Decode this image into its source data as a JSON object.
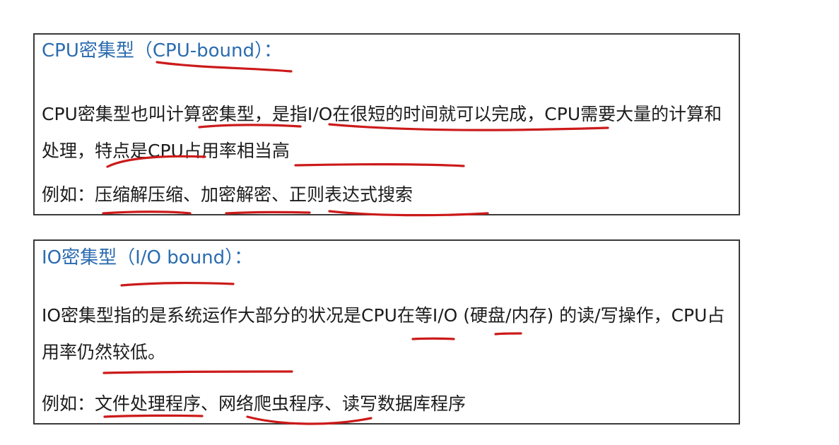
{
  "cpu_section": {
    "title": "CPU密集型（CPU-bound）：",
    "description": "CPU密集型也叫计算密集型，是指I/O在很短的时间就可以完成，CPU需要大量的计算和处理，特点是CPU占用率相当高",
    "example": "例如：压缩解压缩、加密解密、正则表达式搜索"
  },
  "io_section": {
    "title": "IO密集型（I/O bound）：",
    "description": "IO密集型指的是系统运作大部分的状况是CPU在等I/O (硬盘/内存) 的读/写操作，CPU占用率仍然较低。",
    "example": "例如：文件处理程序、网络爬虫程序、读写数据库程序"
  },
  "colors": {
    "heading": "#2b6cb0",
    "text": "#1c1c1c",
    "border": "#3a3a3a",
    "underline": "#cc1a1a"
  }
}
